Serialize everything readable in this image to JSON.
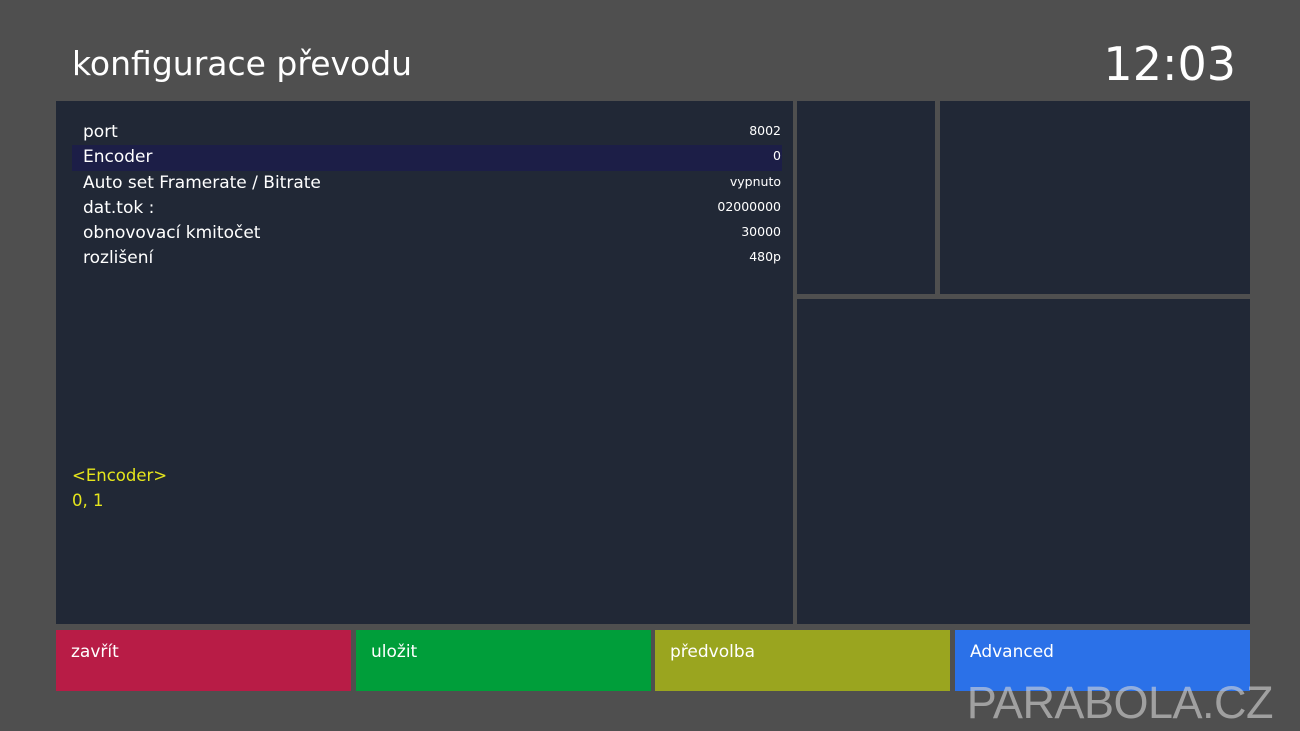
{
  "header": {
    "title": "konfigurace převodu",
    "clock": "12:03"
  },
  "settings": [
    {
      "label": "port",
      "value": "8002"
    },
    {
      "label": "Encoder",
      "value": "0",
      "selected": true
    },
    {
      "label": "Auto set Framerate / Bitrate",
      "value": "vypnuto"
    },
    {
      "label": "dat.tok :",
      "value": "02000000"
    },
    {
      "label": "obnovovací kmitočet",
      "value": "30000"
    },
    {
      "label": "rozlišení",
      "value": "480p"
    }
  ],
  "help": {
    "item": "<Encoder>",
    "options": "0, 1"
  },
  "buttons": {
    "red": "zavřít",
    "green": "uložit",
    "yellow": "předvolba",
    "blue": "Advanced"
  },
  "colors": {
    "background": "#4f4f4f",
    "panel": "#212836",
    "selected_row": "#1c1e47",
    "help_text": "#e5e51c",
    "red": "#b81c46",
    "green": "#009e3a",
    "yellow": "#9aa51f",
    "blue": "#2b71e8"
  },
  "watermark": "PARABOLA.CZ"
}
